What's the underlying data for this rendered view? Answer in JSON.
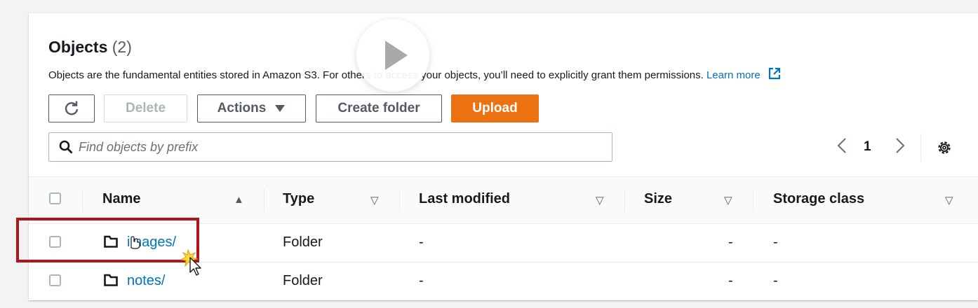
{
  "objects": {
    "title": "Objects",
    "count": "(2)",
    "description": "Objects are the fundamental entities stored in Amazon S3. For others to access your objects, you’ll need to explicitly grant them permissions.",
    "learn_more": "Learn more"
  },
  "toolbar": {
    "refresh_icon": "refresh-icon",
    "delete_label": "Delete",
    "actions_label": "Actions",
    "create_folder_label": "Create folder",
    "upload_label": "Upload"
  },
  "search": {
    "placeholder": "Find objects by prefix"
  },
  "pagination": {
    "current_page": "1"
  },
  "table": {
    "columns": [
      {
        "label": "Name"
      },
      {
        "label": "Type"
      },
      {
        "label": "Last modified"
      },
      {
        "label": "Size"
      },
      {
        "label": "Storage class"
      }
    ],
    "rows": [
      {
        "name": "images/",
        "type": "Folder",
        "last_modified": "-",
        "size": "-",
        "storage_class": "-"
      },
      {
        "name": "notes/",
        "type": "Folder",
        "last_modified": "-",
        "size": "-",
        "storage_class": "-"
      }
    ]
  },
  "colors": {
    "upload": "#ec7211",
    "link": "#0073bb",
    "highlight": "#b0151d"
  }
}
